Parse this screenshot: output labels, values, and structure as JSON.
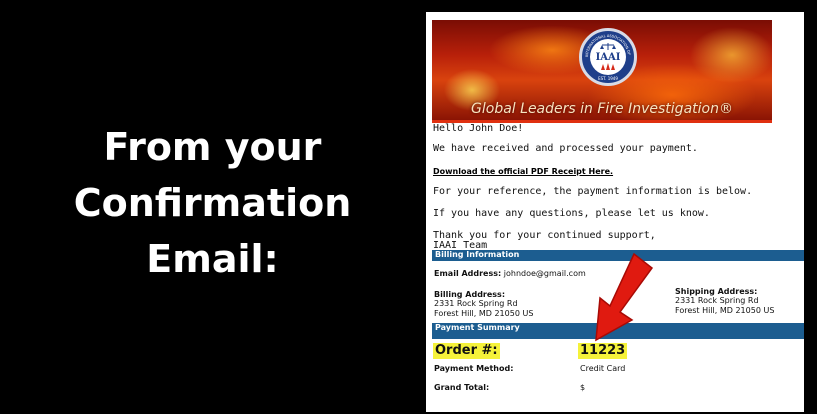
{
  "slide": {
    "title_lines": [
      "From your",
      "Confirmation",
      "Email:"
    ]
  },
  "email": {
    "logo": {
      "acronym": "IAAI",
      "ring_text": "INTERNATIONAL ASSOCIATION OF ARSON INVESTIGATORS",
      "established": "EST. 1949"
    },
    "tagline": "Global Leaders in Fire Investigation®",
    "greeting": "Hello John Doe!",
    "received": "We have received and processed your payment.",
    "receipt_link": "Download the official PDF Receipt Here.",
    "reference": "For your reference, the payment information is below.",
    "questions": "If you have any questions, please let us know.",
    "thanks": "Thank you for your continued support,",
    "signature": "IAAI Team",
    "billing": {
      "header": "Billing Information",
      "email_label": "Email Address:",
      "email_value": "johndoe@gmail.com",
      "billing_label": "Billing Address:",
      "billing_lines": [
        "2331 Rock Spring Rd",
        "Forest Hill, MD 21050 US"
      ],
      "shipping_label": "Shipping Address:",
      "shipping_lines": [
        "2331 Rock Spring Rd",
        "Forest Hill, MD 21050 US"
      ]
    },
    "payment": {
      "header": "Payment Summary",
      "order_label": "Order #:",
      "order_value": "11223",
      "method_label": "Payment Method:",
      "method_value": "Credit Card",
      "total_label": "Grand Total:",
      "total_value": "$"
    }
  },
  "colors": {
    "section_bar": "#1c5d90",
    "highlight": "#f5f23a",
    "arrow": "#e01a10"
  },
  "icons": {
    "logo": "iaai-seal-icon",
    "pointer": "red-arrow-icon"
  }
}
